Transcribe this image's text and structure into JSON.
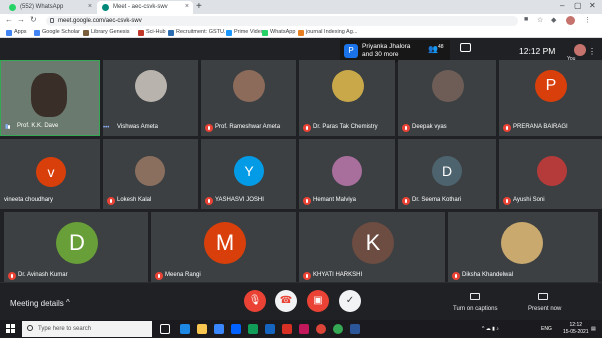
{
  "browser": {
    "tabs": [
      {
        "label": "(552) WhatsApp",
        "color": "#25d366"
      },
      {
        "label": "Meet - aec-csvk-swv",
        "color": "#00897b"
      }
    ],
    "new_tab": "+",
    "url": "meet.google.com/aec-csvk-swv",
    "bookmarks": [
      {
        "label": "Apps",
        "color": "#4285f4"
      },
      {
        "label": "Google Scholar",
        "color": "#4285f4"
      },
      {
        "label": "Library Genesis",
        "color": "#7b5e3c"
      },
      {
        "label": "Sci-Hub",
        "color": "#c0392b"
      },
      {
        "label": "Recruitment: GSTU...",
        "color": "#2b6cb0"
      },
      {
        "label": "Prime Video",
        "color": "#1a98ff"
      },
      {
        "label": "WhatsApp",
        "color": "#25d366"
      },
      {
        "label": "journal Indexing Ag...",
        "color": "#e67e22"
      }
    ]
  },
  "meet": {
    "pinned_name": "Priyanka Jhalora",
    "pinned_more": "and 30 more",
    "pinned_initial": "P",
    "people_count": "48",
    "time": "12:12 PM",
    "you_label": "You",
    "participants": [
      {
        "name": "Prof. K.K. Dave",
        "type": "video",
        "color": "#6b7a6e"
      },
      {
        "name": "Vishwas Ameta",
        "type": "photo",
        "color": "#b8b3ad"
      },
      {
        "name": "Prof. Rameshwar Ameta",
        "type": "photo",
        "color": "#8c6b5a"
      },
      {
        "name": "Dr. Paras Tak Chemistry",
        "type": "photo",
        "color": "#c9a84a"
      },
      {
        "name": "Deepak vyas",
        "type": "photo",
        "color": "#6d5d56"
      },
      {
        "name": "PRERANA BAIRAGI",
        "type": "initial",
        "initial": "P",
        "color": "#d93f0b"
      },
      {
        "name": "vineeta choudhary",
        "type": "initial",
        "initial": "v",
        "color": "#d93f0b"
      },
      {
        "name": "Lokesh Kalal",
        "type": "photo",
        "color": "#8a6e5e"
      },
      {
        "name": "YASHASVI JOSHI",
        "type": "initial",
        "initial": "Y",
        "color": "#039be5"
      },
      {
        "name": "Hemant Malviya",
        "type": "photo",
        "color": "#a86e9c"
      },
      {
        "name": "Dr. Seema Kothari",
        "type": "initial",
        "initial": "D",
        "color": "#4d636e"
      },
      {
        "name": "Ayushi Soni",
        "type": "photo",
        "color": "#b53a3a"
      },
      {
        "name": "Dr. Avinash Kumar",
        "type": "initial",
        "initial": "D",
        "color": "#689f38"
      },
      {
        "name": "Meena Rangi",
        "type": "initial",
        "initial": "M",
        "color": "#d93f0b"
      },
      {
        "name": "KHYATI HARKSHI",
        "type": "initial",
        "initial": "K",
        "color": "#6d4c41"
      },
      {
        "name": "Diksha Khandelwal",
        "type": "photo",
        "color": "#c9a96e"
      }
    ],
    "meeting_details": "Meeting details",
    "captions_label": "Turn on captions",
    "present_label": "Present now"
  },
  "taskbar": {
    "search_placeholder": "Type here to search",
    "language": "ENG",
    "time": "12:12",
    "date": "15-05-2021"
  }
}
